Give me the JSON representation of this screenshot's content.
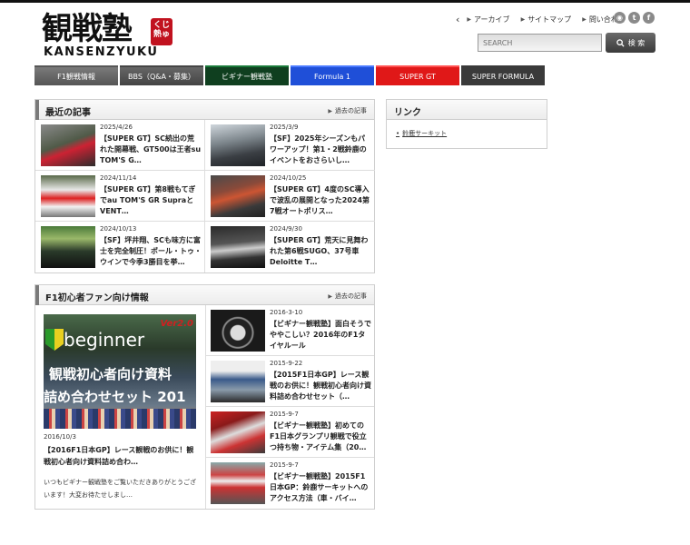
{
  "site": {
    "logo_main": "観戦塾",
    "logo_sub": "KANSENZYUKU",
    "logo_stamp": "くじ熱ゅ"
  },
  "header": {
    "util_links": [
      {
        "label": "アーカイブ"
      },
      {
        "label": "サイトマップ"
      },
      {
        "label": "問い合わせ"
      }
    ],
    "search_placeholder": "SEARCH",
    "search_button": "検 索",
    "social_icons": [
      "rss-icon",
      "twitter-icon",
      "facebook-icon"
    ]
  },
  "nav": {
    "tabs": [
      {
        "label": "F1観戦情報",
        "color": "#6b6b6b"
      },
      {
        "label": "BBS（Q&A・募集）",
        "color": "#555555"
      },
      {
        "label": "ビギナー観戦塾",
        "color": "#0f3f1f"
      },
      {
        "label": "Formula 1",
        "color": "#1f4fd8"
      },
      {
        "label": "SUPER GT",
        "color": "#e01818"
      },
      {
        "label": "SUPER FORMULA",
        "color": "#3a3a3a"
      }
    ]
  },
  "recent": {
    "title": "最近の記事",
    "more": "過去の記事",
    "articles": [
      {
        "date": "2025/4/26",
        "title": "【SUPER GT】SC続出の荒れた開幕戦、GT500は王者su TOM'S G…"
      },
      {
        "date": "2025/3/9",
        "title": "【SF】2025年シーズンもパワーアップ！第1・2戦鈴鹿のイベントをおさらいし…"
      },
      {
        "date": "2024/11/14",
        "title": "【SUPER GT】第8戦もてぎでau TOM'S GR Supraと VENT…"
      },
      {
        "date": "2024/10/25",
        "title": "【SUPER GT】4度のSC導入で波乱の展開となった2024第7戦オートポリス…"
      },
      {
        "date": "2024/10/13",
        "title": "【SF】坪井翔、SCも味方に富士を完全制圧！ポール・トゥ・ウインで今季3勝目を挙…"
      },
      {
        "date": "2024/9/30",
        "title": "【SUPER GT】荒天に見舞われた第6戦SUGO、37号車Deloitte T…"
      }
    ]
  },
  "f1beginner": {
    "title": "F1初心者ファン向け情報",
    "more": "過去の記事",
    "feature": {
      "badge": "beginner",
      "version": "Ver2.0",
      "overlay_line1": "観戦初心者向け資料",
      "overlay_line2": "詰め合わせセット 201",
      "date": "2016/10/3",
      "title": "【2016F1日本GP】レース観戦のお供に！観戦初心者向け資料詰め合わ…",
      "excerpt": "いつもビギナー観戦塾をご覧いただきありがとうございます！大変お待たせしまし…"
    },
    "items": [
      {
        "date": "2016-3-10",
        "title": "【ビギナー観戦塾】面白そうでややこしい？2016年のF1タイヤルール"
      },
      {
        "date": "2015-9-22",
        "title": "【2015F1日本GP】レース観戦のお供に！観戦初心者向け資料詰め合わせセット（…"
      },
      {
        "date": "2015-9-7",
        "title": "【ビギナー観戦塾】初めてのF1日本グランプリ観戦で役立つ持ち物・アイテム集（20…"
      },
      {
        "date": "2015-9-7",
        "title": "【ビギナー観戦塾】2015F1日本GP：鈴鹿サーキットへのアクセス方法（車・バイ…"
      }
    ]
  },
  "links": {
    "title": "リンク",
    "items": [
      {
        "label": "鈴鹿サーキット"
      }
    ]
  },
  "colors": {
    "panel_bar": "#7a7a7a",
    "border": "#cfcfcf"
  }
}
